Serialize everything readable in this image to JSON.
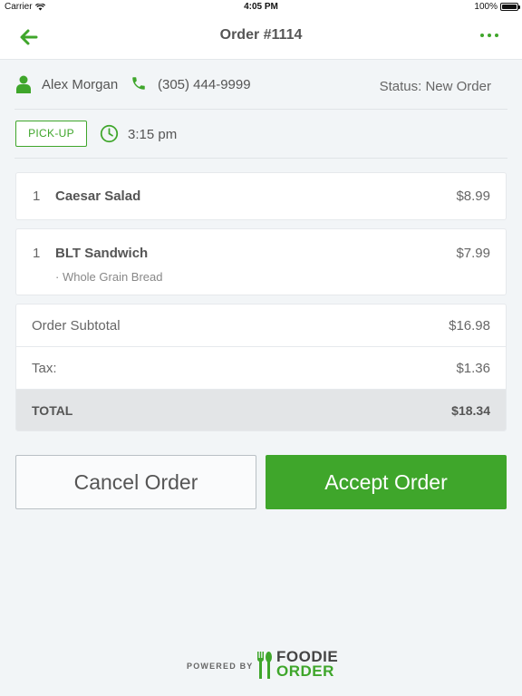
{
  "status_bar": {
    "carrier": "Carrier",
    "time": "4:05 PM",
    "battery": "100%"
  },
  "nav": {
    "title": "Order #1114",
    "back_icon": "arrow-left-icon",
    "more_icon": "more-dots-icon"
  },
  "customer": {
    "name": "Alex Morgan",
    "phone": "(305) 444-9999",
    "status": "Status: New Order"
  },
  "pickup": {
    "type_label": "PICK-UP",
    "time": "3:15 pm"
  },
  "items": [
    {
      "qty": "1",
      "name": "Caesar Salad",
      "price": "$8.99",
      "modifiers": []
    },
    {
      "qty": "1",
      "name": "BLT Sandwich",
      "price": "$7.99",
      "modifiers": [
        "· Whole Grain Bread"
      ]
    }
  ],
  "totals": {
    "subtotal_label": "Order Subtotal",
    "subtotal_value": "$16.98",
    "tax_label": "Tax:",
    "tax_value": "$1.36",
    "total_label": "TOTAL",
    "total_value": "$18.34"
  },
  "actions": {
    "cancel_label": "Cancel Order",
    "accept_label": "Accept Order"
  },
  "footer": {
    "powered_by": "POWERED BY",
    "brand_top": "FOODIE",
    "brand_bottom": "ORDER"
  },
  "colors": {
    "accent": "#3fa62b",
    "background": "#f2f5f7",
    "total_row": "#e3e5e7"
  }
}
